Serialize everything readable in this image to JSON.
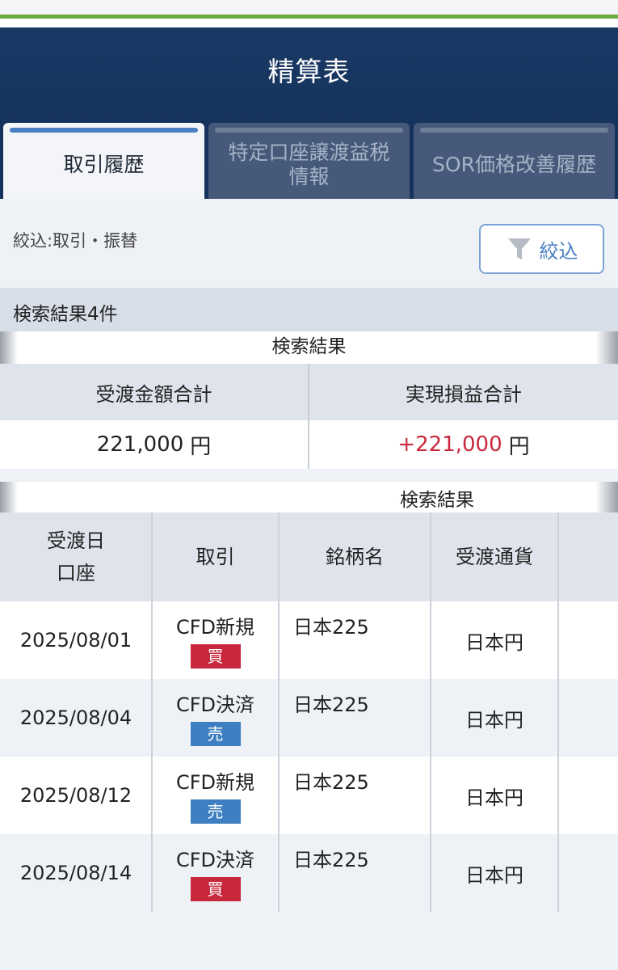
{
  "header": {
    "title": "精算表"
  },
  "tabs": [
    {
      "label": "取引履歴",
      "active": true
    },
    {
      "label": "特定口座譲渡益税情報",
      "active": false
    },
    {
      "label": "SOR価格改善履歴",
      "active": false
    }
  ],
  "filter": {
    "label": "絞込:取引・振替",
    "button_label": "絞込"
  },
  "result_count": "検索結果4件",
  "summary": {
    "caption": "検索結果",
    "col1_header": "受渡金額合計",
    "col1_value": "221,000",
    "col2_header": "実現損益合計",
    "col2_value": "+221,000",
    "unit": "円"
  },
  "list": {
    "caption": "検索結果",
    "headers": {
      "date_line1": "受渡日",
      "date_line2": "口座",
      "trade": "取引",
      "name": "銘柄名",
      "currency": "受渡通貨"
    },
    "rows": [
      {
        "date": "2025/08/01",
        "trade": "CFD新規",
        "side": "買",
        "name": "日本225",
        "currency": "日本円"
      },
      {
        "date": "2025/08/04",
        "trade": "CFD決済",
        "side": "売",
        "name": "日本225",
        "currency": "日本円"
      },
      {
        "date": "2025/08/12",
        "trade": "CFD新規",
        "side": "売",
        "name": "日本225",
        "currency": "日本円"
      },
      {
        "date": "2025/08/14",
        "trade": "CFD決済",
        "side": "買",
        "name": "日本225",
        "currency": "日本円"
      }
    ]
  },
  "colors": {
    "header": "#15335c",
    "accent": "#4a7fc4",
    "buy": "#c8283c",
    "sell": "#3d7fc2",
    "green": "#6aab3d"
  },
  "icons": {
    "filter": "funnel-icon"
  }
}
